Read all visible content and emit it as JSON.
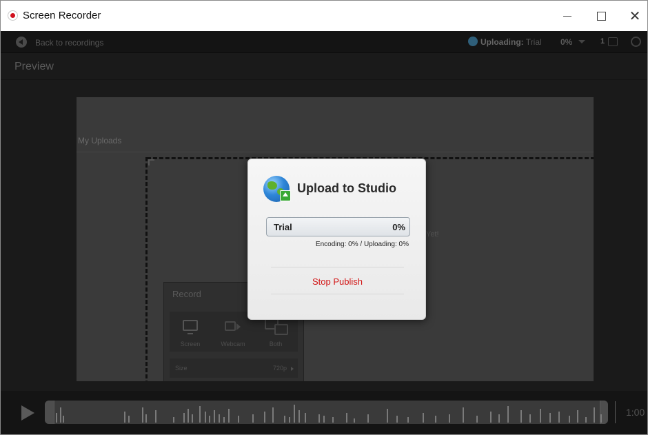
{
  "window": {
    "title": "Screen Recorder"
  },
  "toolbar": {
    "back_label": "Back to recordings",
    "uploading_prefix": "Uploading:",
    "uploading_name": "Trial",
    "uploading_pct": "0%",
    "queue_count": "1"
  },
  "preview": {
    "title": "Preview",
    "uploads_label": "My Uploads",
    "empty_hint_fragment": "Yet!"
  },
  "record_panel": {
    "title": "Record",
    "sources": [
      "Screen",
      "Webcam",
      "Both"
    ],
    "size_label": "Size",
    "size_value": "720p"
  },
  "dialog": {
    "title": "Upload to Studio",
    "progress_label": "Trial",
    "progress_pct": "0%",
    "progress_fraction": 0.0,
    "status": "Encoding: 0% / Uploading: 0%",
    "stop_button": "Stop Publish"
  },
  "timeline": {
    "time_label": "1:00"
  },
  "colors": {
    "stop_text": "#d21414",
    "progress_fill": "#5b9bd5",
    "record_dot": "#d0101e"
  }
}
